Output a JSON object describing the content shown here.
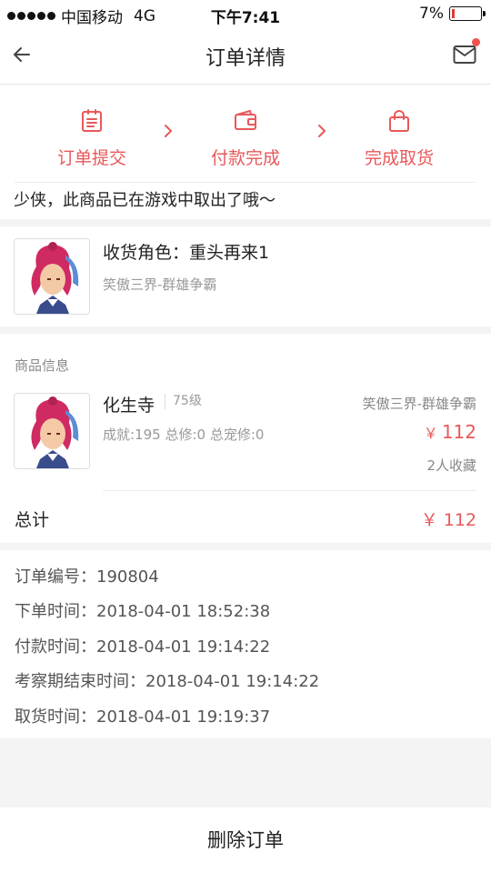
{
  "status_bar": {
    "carrier": "中国移动",
    "network": "4G",
    "time": "下午7:41",
    "battery": "7%"
  },
  "nav": {
    "title": "订单详情"
  },
  "progress": {
    "steps": [
      {
        "label": "订单提交",
        "icon": "order-list-icon"
      },
      {
        "label": "付款完成",
        "icon": "wallet-icon"
      },
      {
        "label": "完成取货",
        "icon": "shopping-bag-icon"
      }
    ]
  },
  "notice": "少侠，此商品已在游戏中取出了哦～",
  "receiver": {
    "title": "收货角色：重头再来1",
    "server": "笑傲三界-群雄争霸"
  },
  "goods": {
    "section_label": "商品信息",
    "name": "化生寺",
    "level": "75级",
    "server": "笑傲三界-群雄争霸",
    "stats": "成就:195 总修:0 总宠修:0",
    "price_symbol": "￥",
    "price": "112",
    "favorites": "2人收藏"
  },
  "total": {
    "label": "总计",
    "value": "￥ 112"
  },
  "order_info": {
    "rows": [
      "订单编号：190804",
      "下单时间：2018-04-01 18:52:38",
      "付款时间：2018-04-01 19:14:22",
      "考察期结束时间：2018-04-01 19:14:22",
      "取货时间：2018-04-01 19:19:37"
    ]
  },
  "actions": {
    "delete_label": "删除订单"
  },
  "colors": {
    "accent": "#e8585a",
    "background": "#f4f4f4"
  }
}
